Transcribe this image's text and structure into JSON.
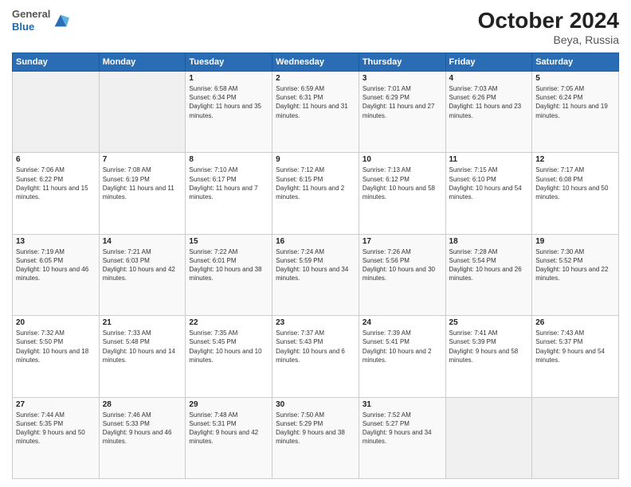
{
  "header": {
    "logo": {
      "line1": "General",
      "line2": "Blue"
    },
    "title": "October 2024",
    "subtitle": "Beya, Russia"
  },
  "weekdays": [
    "Sunday",
    "Monday",
    "Tuesday",
    "Wednesday",
    "Thursday",
    "Friday",
    "Saturday"
  ],
  "weeks": [
    [
      {
        "day": "",
        "empty": true
      },
      {
        "day": "",
        "empty": true
      },
      {
        "day": "1",
        "sunrise": "Sunrise: 6:58 AM",
        "sunset": "Sunset: 6:34 PM",
        "daylight": "Daylight: 11 hours and 35 minutes."
      },
      {
        "day": "2",
        "sunrise": "Sunrise: 6:59 AM",
        "sunset": "Sunset: 6:31 PM",
        "daylight": "Daylight: 11 hours and 31 minutes."
      },
      {
        "day": "3",
        "sunrise": "Sunrise: 7:01 AM",
        "sunset": "Sunset: 6:29 PM",
        "daylight": "Daylight: 11 hours and 27 minutes."
      },
      {
        "day": "4",
        "sunrise": "Sunrise: 7:03 AM",
        "sunset": "Sunset: 6:26 PM",
        "daylight": "Daylight: 11 hours and 23 minutes."
      },
      {
        "day": "5",
        "sunrise": "Sunrise: 7:05 AM",
        "sunset": "Sunset: 6:24 PM",
        "daylight": "Daylight: 11 hours and 19 minutes."
      }
    ],
    [
      {
        "day": "6",
        "sunrise": "Sunrise: 7:06 AM",
        "sunset": "Sunset: 6:22 PM",
        "daylight": "Daylight: 11 hours and 15 minutes."
      },
      {
        "day": "7",
        "sunrise": "Sunrise: 7:08 AM",
        "sunset": "Sunset: 6:19 PM",
        "daylight": "Daylight: 11 hours and 11 minutes."
      },
      {
        "day": "8",
        "sunrise": "Sunrise: 7:10 AM",
        "sunset": "Sunset: 6:17 PM",
        "daylight": "Daylight: 11 hours and 7 minutes."
      },
      {
        "day": "9",
        "sunrise": "Sunrise: 7:12 AM",
        "sunset": "Sunset: 6:15 PM",
        "daylight": "Daylight: 11 hours and 2 minutes."
      },
      {
        "day": "10",
        "sunrise": "Sunrise: 7:13 AM",
        "sunset": "Sunset: 6:12 PM",
        "daylight": "Daylight: 10 hours and 58 minutes."
      },
      {
        "day": "11",
        "sunrise": "Sunrise: 7:15 AM",
        "sunset": "Sunset: 6:10 PM",
        "daylight": "Daylight: 10 hours and 54 minutes."
      },
      {
        "day": "12",
        "sunrise": "Sunrise: 7:17 AM",
        "sunset": "Sunset: 6:08 PM",
        "daylight": "Daylight: 10 hours and 50 minutes."
      }
    ],
    [
      {
        "day": "13",
        "sunrise": "Sunrise: 7:19 AM",
        "sunset": "Sunset: 6:05 PM",
        "daylight": "Daylight: 10 hours and 46 minutes."
      },
      {
        "day": "14",
        "sunrise": "Sunrise: 7:21 AM",
        "sunset": "Sunset: 6:03 PM",
        "daylight": "Daylight: 10 hours and 42 minutes."
      },
      {
        "day": "15",
        "sunrise": "Sunrise: 7:22 AM",
        "sunset": "Sunset: 6:01 PM",
        "daylight": "Daylight: 10 hours and 38 minutes."
      },
      {
        "day": "16",
        "sunrise": "Sunrise: 7:24 AM",
        "sunset": "Sunset: 5:59 PM",
        "daylight": "Daylight: 10 hours and 34 minutes."
      },
      {
        "day": "17",
        "sunrise": "Sunrise: 7:26 AM",
        "sunset": "Sunset: 5:56 PM",
        "daylight": "Daylight: 10 hours and 30 minutes."
      },
      {
        "day": "18",
        "sunrise": "Sunrise: 7:28 AM",
        "sunset": "Sunset: 5:54 PM",
        "daylight": "Daylight: 10 hours and 26 minutes."
      },
      {
        "day": "19",
        "sunrise": "Sunrise: 7:30 AM",
        "sunset": "Sunset: 5:52 PM",
        "daylight": "Daylight: 10 hours and 22 minutes."
      }
    ],
    [
      {
        "day": "20",
        "sunrise": "Sunrise: 7:32 AM",
        "sunset": "Sunset: 5:50 PM",
        "daylight": "Daylight: 10 hours and 18 minutes."
      },
      {
        "day": "21",
        "sunrise": "Sunrise: 7:33 AM",
        "sunset": "Sunset: 5:48 PM",
        "daylight": "Daylight: 10 hours and 14 minutes."
      },
      {
        "day": "22",
        "sunrise": "Sunrise: 7:35 AM",
        "sunset": "Sunset: 5:45 PM",
        "daylight": "Daylight: 10 hours and 10 minutes."
      },
      {
        "day": "23",
        "sunrise": "Sunrise: 7:37 AM",
        "sunset": "Sunset: 5:43 PM",
        "daylight": "Daylight: 10 hours and 6 minutes."
      },
      {
        "day": "24",
        "sunrise": "Sunrise: 7:39 AM",
        "sunset": "Sunset: 5:41 PM",
        "daylight": "Daylight: 10 hours and 2 minutes."
      },
      {
        "day": "25",
        "sunrise": "Sunrise: 7:41 AM",
        "sunset": "Sunset: 5:39 PM",
        "daylight": "Daylight: 9 hours and 58 minutes."
      },
      {
        "day": "26",
        "sunrise": "Sunrise: 7:43 AM",
        "sunset": "Sunset: 5:37 PM",
        "daylight": "Daylight: 9 hours and 54 minutes."
      }
    ],
    [
      {
        "day": "27",
        "sunrise": "Sunrise: 7:44 AM",
        "sunset": "Sunset: 5:35 PM",
        "daylight": "Daylight: 9 hours and 50 minutes."
      },
      {
        "day": "28",
        "sunrise": "Sunrise: 7:46 AM",
        "sunset": "Sunset: 5:33 PM",
        "daylight": "Daylight: 9 hours and 46 minutes."
      },
      {
        "day": "29",
        "sunrise": "Sunrise: 7:48 AM",
        "sunset": "Sunset: 5:31 PM",
        "daylight": "Daylight: 9 hours and 42 minutes."
      },
      {
        "day": "30",
        "sunrise": "Sunrise: 7:50 AM",
        "sunset": "Sunset: 5:29 PM",
        "daylight": "Daylight: 9 hours and 38 minutes."
      },
      {
        "day": "31",
        "sunrise": "Sunrise: 7:52 AM",
        "sunset": "Sunset: 5:27 PM",
        "daylight": "Daylight: 9 hours and 34 minutes."
      },
      {
        "day": "",
        "empty": true
      },
      {
        "day": "",
        "empty": true
      }
    ]
  ]
}
